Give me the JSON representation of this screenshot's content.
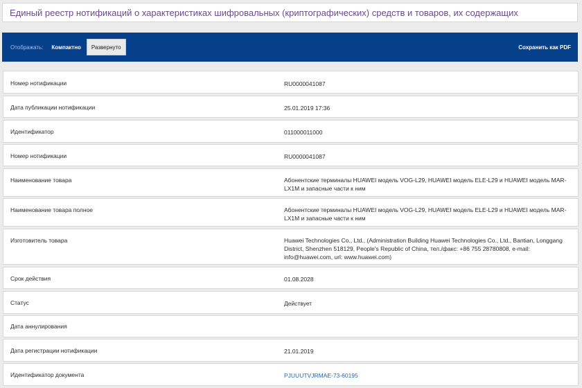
{
  "header": {
    "title": "Единый реестр нотификаций о характеристиках шифровальных (криптографических) средств и товаров, их содержащих"
  },
  "toolbar": {
    "display_label": "Отображать:",
    "compact_label": "Компактно",
    "expanded_label": "Развернуто",
    "save_pdf_label": "Сохранить как PDF"
  },
  "rows": [
    {
      "label": "Номер нотификации",
      "value": "RU0000041087"
    },
    {
      "label": "Дата публикации нотификации",
      "value": "25.01.2019 17:36"
    },
    {
      "label": "Идентификатор",
      "value": "011000011000"
    },
    {
      "label": "Номер нотификации",
      "value": "RU0000041087"
    },
    {
      "label": "Наименование товара",
      "value": "Абонентские терминалы HUAWEI модель VOG-L29, HUAWEI модель ELE-L29 и HUAWEI модель MAR-LX1M и запасные части к ним"
    },
    {
      "label": "Наименование товара полное",
      "value": "Абонентские терминалы HUAWEI модель VOG-L29, HUAWEI модель ELE-L29 и HUAWEI модель MAR-LX1M и запасные части к ним"
    },
    {
      "label": "Изготовитель товара",
      "value": "Huawei Technologies Co., Ltd., (Administration Building Huawei Technologies Co., Ltd., Bantian, Longgang District, Shenzhen 518129, People's Republic of China, тел./факс: +86 755 28780808, e-mail: info@huawei.com, url: www.huawei.com)"
    },
    {
      "label": "Срок действия",
      "value": "01.08.2028"
    },
    {
      "label": "Статус",
      "value": "Действует"
    },
    {
      "label": "Дата аннулирования",
      "value": ""
    },
    {
      "label": "Дата регистрации нотификации",
      "value": "21.01.2019"
    },
    {
      "label": "Идентификатор документа",
      "value": "PJUUUTVJRMAE-73-60195"
    }
  ]
}
